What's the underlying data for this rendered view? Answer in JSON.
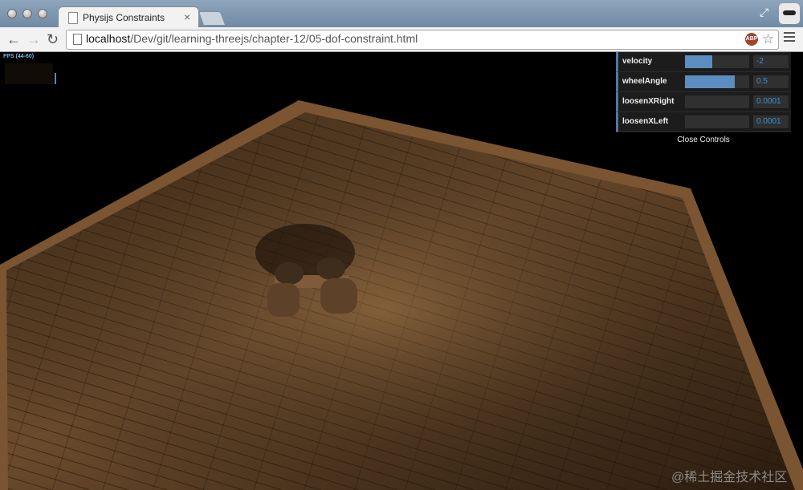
{
  "browser": {
    "tab_title": "Physijs Constraints",
    "tab_close": "×",
    "url_host": "localhost",
    "url_path": "/Dev/git/learning-threejs/chapter-12/05-dof-constraint.html",
    "ext_label": "ABP"
  },
  "stats": {
    "label": "FPS (44-60)"
  },
  "controls": {
    "rows": [
      {
        "name": "velocity",
        "value": "-2",
        "level": 0.42
      },
      {
        "name": "wheelAngle",
        "value": "0.5",
        "level": 0.78
      },
      {
        "name": "loosenXRight",
        "value": "0.0001",
        "level": 0.0
      },
      {
        "name": "loosenXLeft",
        "value": "0.0001",
        "level": 0.0
      }
    ],
    "close_label": "Close Controls"
  },
  "watermark": "@稀土掘金技术社区",
  "colors": {
    "gui_accent": "#5b8dc0",
    "number_text": "#3b8fd6",
    "floor_wood": "#6a4a2a",
    "frame_wood": "#9a6a3e"
  }
}
